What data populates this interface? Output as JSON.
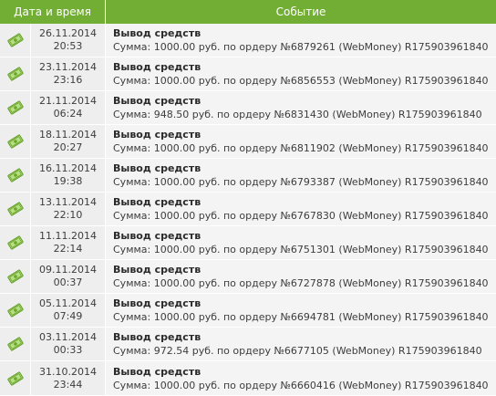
{
  "header": {
    "date_label": "Дата и время",
    "event_label": "Событие"
  },
  "colors": {
    "header_bg": "#72ae33",
    "row_bg": "#f4f4f4",
    "icon": "#6aa82a"
  },
  "icon_name": "money-bill-icon",
  "rows": [
    {
      "date": "26.11.2014",
      "time": "20:53",
      "title": "Вывод средств",
      "desc": "Сумма: 1000.00 руб. по ордеру №6879261 (WebMoney) R175903961840"
    },
    {
      "date": "23.11.2014",
      "time": "23:16",
      "title": "Вывод средств",
      "desc": "Сумма: 1000.00 руб. по ордеру №6856553 (WebMoney) R175903961840"
    },
    {
      "date": "21.11.2014",
      "time": "06:24",
      "title": "Вывод средств",
      "desc": "Сумма: 948.50 руб. по ордеру №6831430 (WebMoney) R175903961840"
    },
    {
      "date": "18.11.2014",
      "time": "20:27",
      "title": "Вывод средств",
      "desc": "Сумма: 1000.00 руб. по ордеру №6811902 (WebMoney) R175903961840"
    },
    {
      "date": "16.11.2014",
      "time": "19:38",
      "title": "Вывод средств",
      "desc": "Сумма: 1000.00 руб. по ордеру №6793387 (WebMoney) R175903961840"
    },
    {
      "date": "13.11.2014",
      "time": "22:10",
      "title": "Вывод средств",
      "desc": "Сумма: 1000.00 руб. по ордеру №6767830 (WebMoney) R175903961840"
    },
    {
      "date": "11.11.2014",
      "time": "22:14",
      "title": "Вывод средств",
      "desc": "Сумма: 1000.00 руб. по ордеру №6751301 (WebMoney) R175903961840"
    },
    {
      "date": "09.11.2014",
      "time": "00:37",
      "title": "Вывод средств",
      "desc": "Сумма: 1000.00 руб. по ордеру №6727878 (WebMoney) R175903961840"
    },
    {
      "date": "05.11.2014",
      "time": "07:49",
      "title": "Вывод средств",
      "desc": "Сумма: 1000.00 руб. по ордеру №6694781 (WebMoney) R175903961840"
    },
    {
      "date": "03.11.2014",
      "time": "00:33",
      "title": "Вывод средств",
      "desc": "Сумма: 972.54 руб. по ордеру №6677105 (WebMoney) R175903961840"
    },
    {
      "date": "31.10.2014",
      "time": "23:44",
      "title": "Вывод средств",
      "desc": "Сумма: 1000.00 руб. по ордеру №6660416 (WebMoney) R175903961840"
    }
  ]
}
